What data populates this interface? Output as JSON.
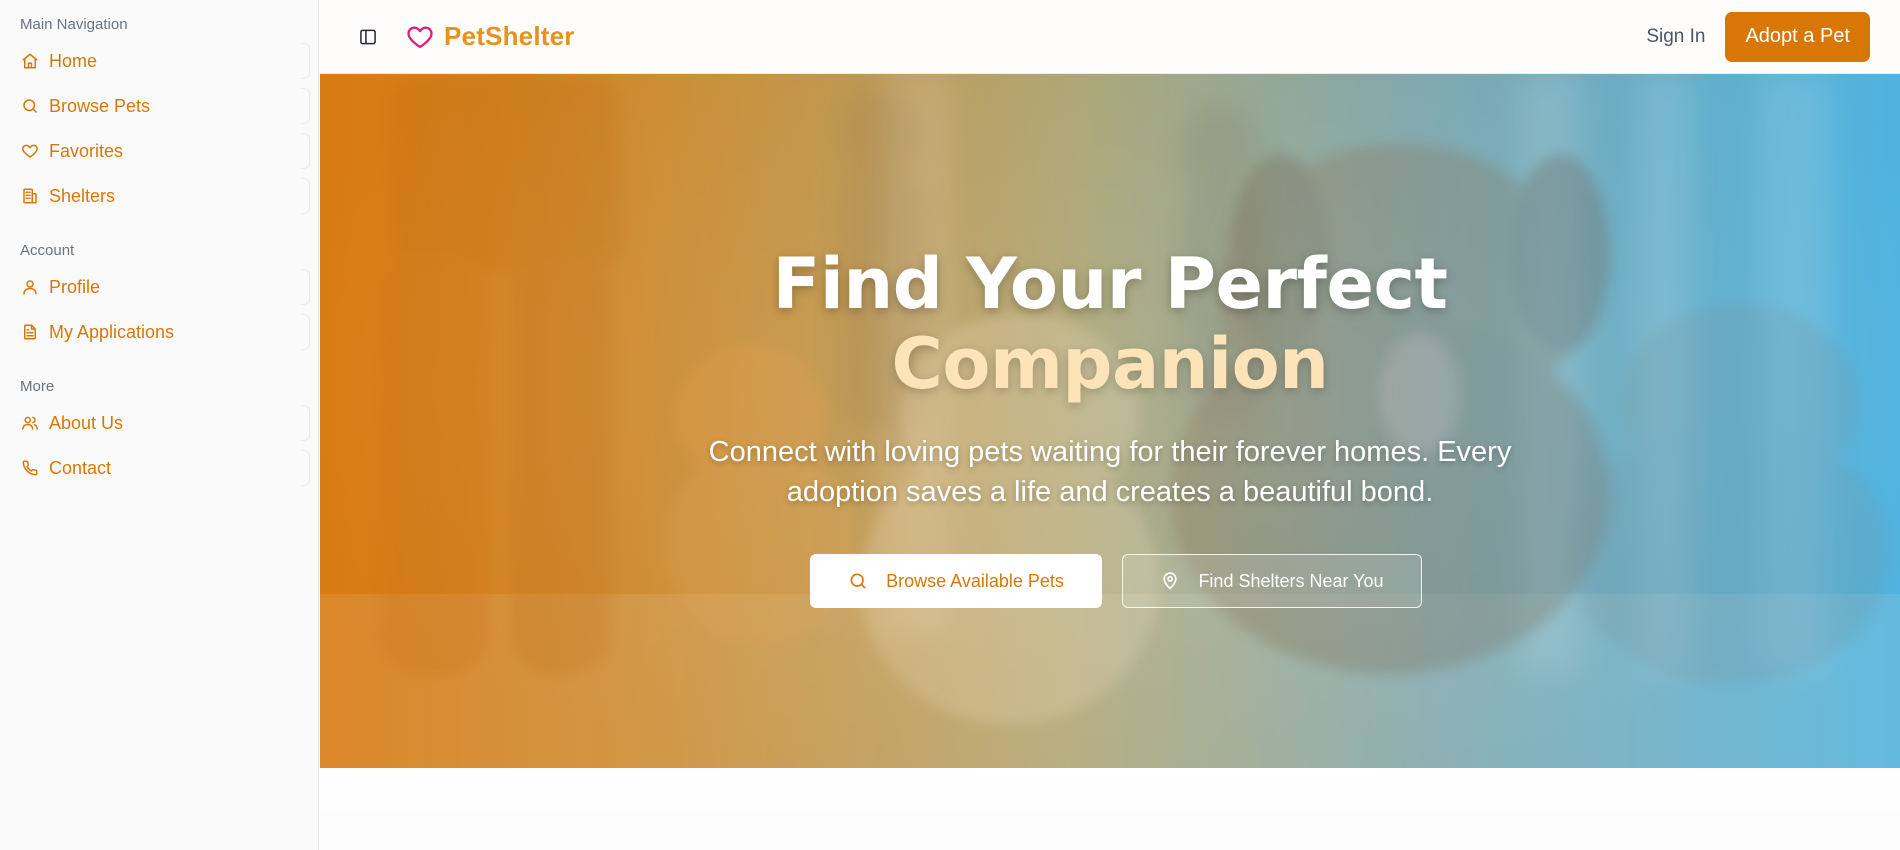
{
  "sidebar": {
    "groups": [
      {
        "label": "Main Navigation",
        "items": [
          {
            "label": "Home",
            "icon": "home-icon"
          },
          {
            "label": "Browse Pets",
            "icon": "search-icon"
          },
          {
            "label": "Favorites",
            "icon": "heart-icon"
          },
          {
            "label": "Shelters",
            "icon": "building-icon"
          }
        ]
      },
      {
        "label": "Account",
        "items": [
          {
            "label": "Profile",
            "icon": "user-icon"
          },
          {
            "label": "My Applications",
            "icon": "document-icon"
          }
        ]
      },
      {
        "label": "More",
        "items": [
          {
            "label": "About Us",
            "icon": "users-icon"
          },
          {
            "label": "Contact",
            "icon": "phone-icon"
          }
        ]
      }
    ]
  },
  "header": {
    "brand": "PetShelter",
    "sign_in": "Sign In",
    "adopt": "Adopt a Pet"
  },
  "hero": {
    "title": "Find Your Perfect",
    "title_accent": "Companion",
    "subtitle": "Connect with loving pets waiting for their forever homes. Every adoption saves a life and creates a beautiful bond.",
    "primary_button": "Browse Available Pets",
    "secondary_button": "Find Shelters Near You"
  },
  "colors": {
    "accent": "#d97706",
    "brand_text": "#e6921e",
    "heart": "#e11d74",
    "title_accent": "#fde3b8"
  }
}
